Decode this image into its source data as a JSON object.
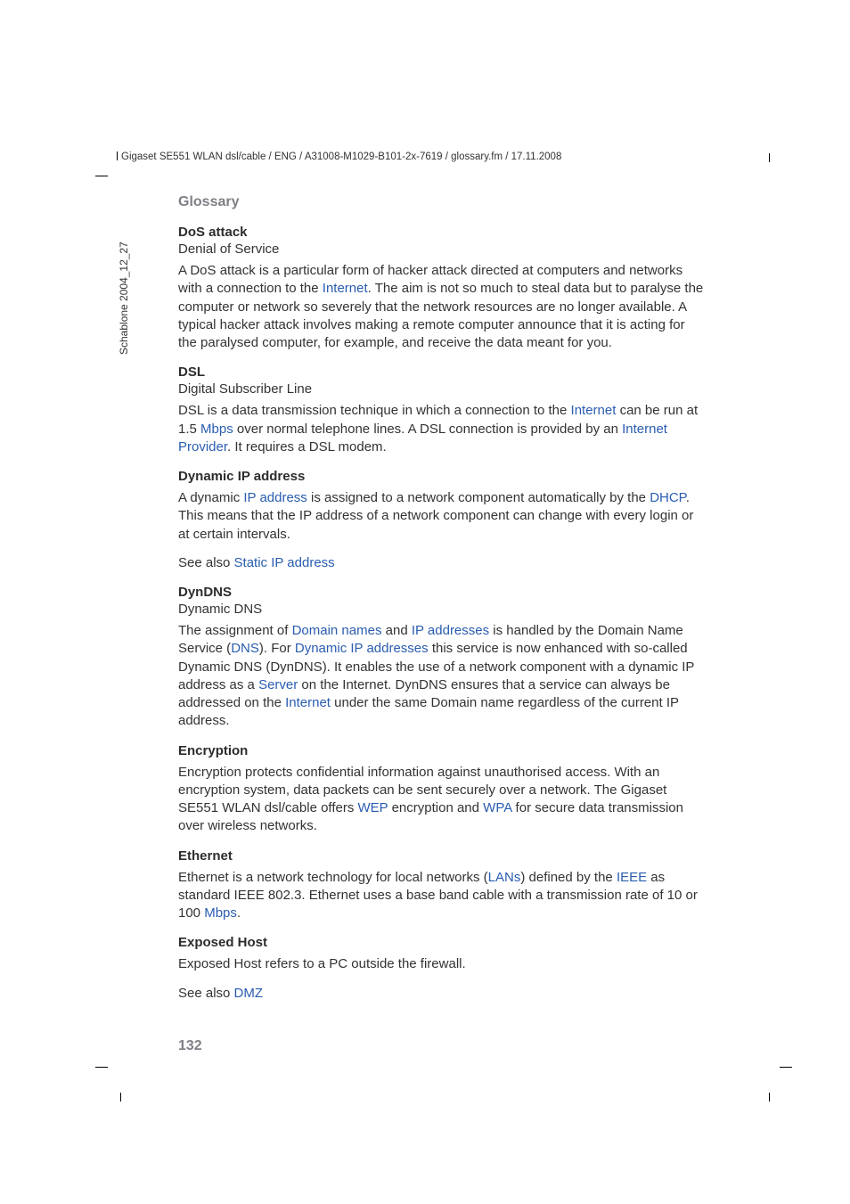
{
  "header": {
    "path": "Gigaset SE551 WLAN dsl/cable / ENG / A31008-M1029-B101-2x-7619 / glossary.fm / 17.11.2008"
  },
  "sidebar": {
    "label": "Schablone 2004_12_27"
  },
  "section_title": "Glossary",
  "entries": {
    "dos": {
      "term": "DoS attack",
      "sub": "Denial of Service",
      "p1a": "A DoS attack is a particular form of hacker attack directed at computers and networks with a connection to the ",
      "p1_link1": "Internet",
      "p1b": ". The aim is not so much to steal data but to paralyse the computer or network so severely that the network resources are no longer available. A typical hacker attack involves making a remote computer announce that it is acting for the paralysed computer, for example, and receive the data meant for you."
    },
    "dsl": {
      "term": "DSL",
      "sub": "Digital Subscriber Line",
      "p1a": "DSL is a data transmission technique in which a connection to the ",
      "p1_link1": "Internet",
      "p1b": " can be run at 1.5 ",
      "p1_link2": "Mbps",
      "p1c": " over normal telephone lines. A DSL connection is provided by an ",
      "p1_link3": "Internet Provider",
      "p1d": ". It requires a DSL modem."
    },
    "dynip": {
      "term": "Dynamic IP address",
      "p1a": "A dynamic ",
      "p1_link1": "IP address",
      "p1b": " is assigned to a network component automatically by the ",
      "p1_link2": "DHCP",
      "p1c": ". This means that the IP address of a network component can change with every login or at certain intervals.",
      "p2a": "See also ",
      "p2_link1": "Static IP address"
    },
    "dyndns": {
      "term": "DynDNS",
      "sub": "Dynamic DNS",
      "p1a": "The assignment of ",
      "p1_link1": "Domain names",
      "p1b": " and ",
      "p1_link2": "IP addresses",
      "p1c": " is handled by the Domain Name Service (",
      "p1_link3": "DNS",
      "p1d": "). For ",
      "p1_link4": "Dynamic IP addresses",
      "p1e": " this service is now enhanced with so-called Dynamic DNS (DynDNS). It enables the use of a network component with a dynamic IP address as a ",
      "p1_link5": "Server",
      "p1f": " on the Internet. DynDNS ensures that a service can always be addressed on the ",
      "p1_link6": "Internet",
      "p1g": " under the same Domain name regardless of the current IP address."
    },
    "encryption": {
      "term": "Encryption",
      "p1a": "Encryption protects confidential information against unauthorised access. With an encryption system, data packets can be sent securely over a network. The Gigaset SE551 WLAN dsl/cable offers ",
      "p1_link1": "WEP",
      "p1b": " encryption and ",
      "p1_link2": "WPA",
      "p1c": " for secure data transmission over wireless networks."
    },
    "ethernet": {
      "term": "Ethernet",
      "p1a": "Ethernet is a network technology for local networks (",
      "p1_link1": "LANs",
      "p1b": ") defined by the ",
      "p1_link2": "IEEE",
      "p1c": " as standard IEEE 802.3. Ethernet uses a base band cable with a transmission rate of 10 or 100 ",
      "p1_link3": "Mbps",
      "p1d": "."
    },
    "exposed": {
      "term": "Exposed Host",
      "p1": "Exposed Host refers to a PC outside the firewall.",
      "p2a": "See also ",
      "p2_link1": "DMZ"
    }
  },
  "page_number": "132"
}
